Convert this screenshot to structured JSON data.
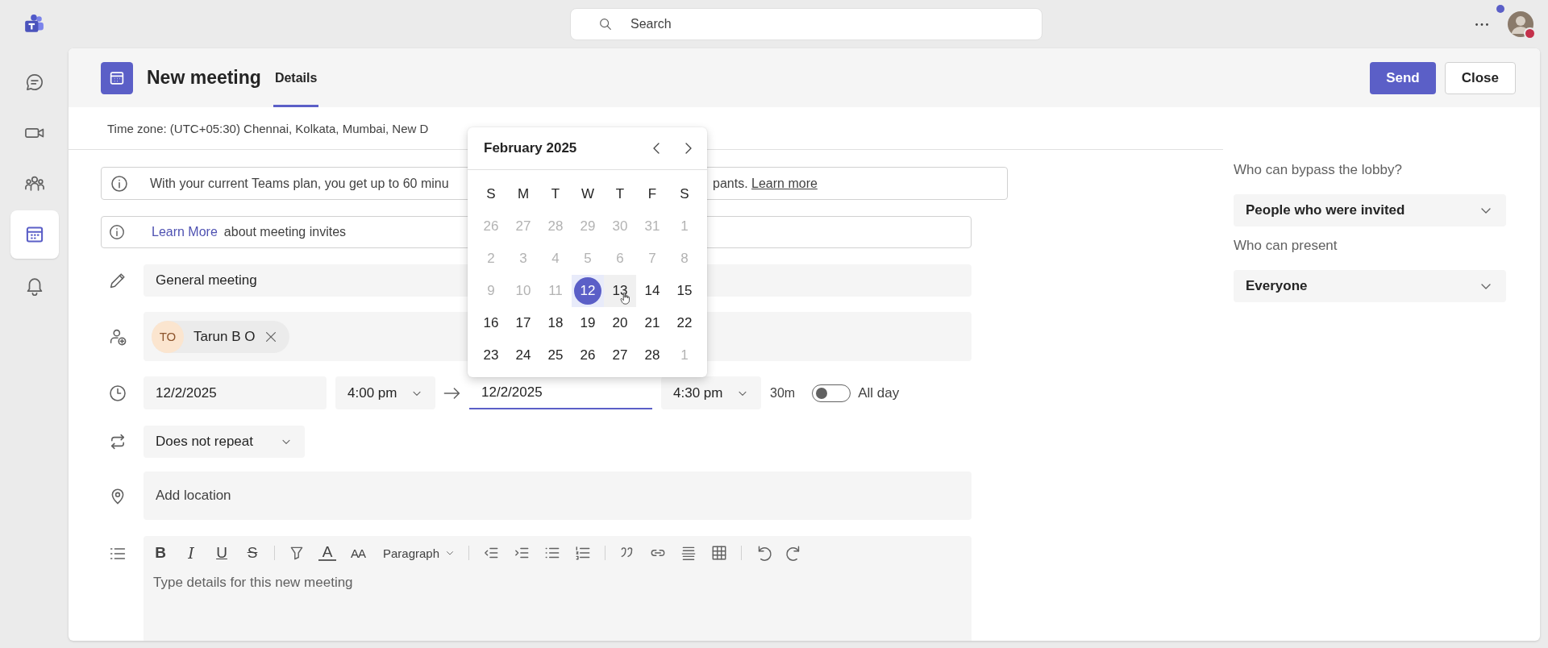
{
  "app_bar": {
    "search": {
      "placeholder": "Search"
    }
  },
  "rail": [
    {
      "kind": "chat",
      "selected": false
    },
    {
      "kind": "video",
      "selected": false
    },
    {
      "kind": "people",
      "selected": false
    },
    {
      "kind": "calendar",
      "selected": true
    },
    {
      "kind": "bell",
      "selected": false
    }
  ],
  "meeting": {
    "title": "New meeting",
    "tabs": [
      {
        "label": "Details",
        "selected": true
      }
    ],
    "buttons": [
      {
        "label": "Send",
        "kind": "primary"
      },
      {
        "label": "Close",
        "kind": "secondary"
      }
    ]
  },
  "time_zone": "Time zone: (UTC+05:30) Chennai, Kolkata, Mumbai, New D",
  "plan_notice": {
    "text": "With your current Teams plan, you get up to 60 minu",
    "text_after": "pants.",
    "link": "Learn more"
  },
  "invite_notice": {
    "link": "Learn More",
    "text": "about meeting invites"
  },
  "title_field": {
    "value": "General meeting"
  },
  "attendees": [
    {
      "initials": "TO",
      "name": "Tarun B O"
    }
  ],
  "schedule": {
    "start_date": "12/2/2025",
    "start_time": "4:00 pm",
    "end_date": "12/2/2025",
    "end_date_focused": true,
    "end_time": "4:30 pm",
    "duration": "30m",
    "all_day": {
      "label": "All day",
      "on": false
    }
  },
  "repeat": {
    "value": "Does not repeat"
  },
  "location": {
    "placeholder": "Add location"
  },
  "editor": {
    "toolbar": [
      {
        "kind": "bold",
        "label": "B"
      },
      {
        "kind": "italic",
        "label": "I"
      },
      {
        "kind": "underline",
        "label": "U"
      },
      {
        "kind": "strikethrough",
        "label": "S"
      },
      {
        "kind": "separator"
      },
      {
        "kind": "highlight"
      },
      {
        "kind": "font-color",
        "label": "A"
      },
      {
        "kind": "font-size",
        "label": "AA"
      },
      {
        "kind": "paragraph",
        "label": "Paragraph"
      },
      {
        "kind": "separator"
      },
      {
        "kind": "outdent"
      },
      {
        "kind": "indent"
      },
      {
        "kind": "bullets"
      },
      {
        "kind": "numbering"
      },
      {
        "kind": "separator"
      },
      {
        "kind": "quote"
      },
      {
        "kind": "link"
      },
      {
        "kind": "rule"
      },
      {
        "kind": "table"
      },
      {
        "kind": "separator"
      },
      {
        "kind": "undo"
      },
      {
        "kind": "redo"
      }
    ],
    "placeholder": "Type details for this new meeting"
  },
  "date_picker": {
    "month": "February 2025",
    "weekdays": [
      "S",
      "M",
      "T",
      "W",
      "T",
      "F",
      "S"
    ],
    "weeks": [
      [
        {
          "day": "26",
          "muted": true,
          "selected": false,
          "hovered": false
        },
        {
          "day": "27",
          "muted": true,
          "selected": false,
          "hovered": false
        },
        {
          "day": "28",
          "muted": true,
          "selected": false,
          "hovered": false
        },
        {
          "day": "29",
          "muted": true,
          "selected": false,
          "hovered": false
        },
        {
          "day": "30",
          "muted": true,
          "selected": false,
          "hovered": false
        },
        {
          "day": "31",
          "muted": true,
          "selected": false,
          "hovered": false
        },
        {
          "day": "1",
          "muted": true,
          "selected": false,
          "hovered": false
        }
      ],
      [
        {
          "day": "2",
          "muted": true,
          "selected": false,
          "hovered": false
        },
        {
          "day": "3",
          "muted": true,
          "selected": false,
          "hovered": false
        },
        {
          "day": "4",
          "muted": true,
          "selected": false,
          "hovered": false
        },
        {
          "day": "5",
          "muted": true,
          "selected": false,
          "hovered": false
        },
        {
          "day": "6",
          "muted": true,
          "selected": false,
          "hovered": false
        },
        {
          "day": "7",
          "muted": true,
          "selected": false,
          "hovered": false
        },
        {
          "day": "8",
          "muted": true,
          "selected": false,
          "hovered": false
        }
      ],
      [
        {
          "day": "9",
          "muted": true,
          "selected": false,
          "hovered": false
        },
        {
          "day": "10",
          "muted": true,
          "selected": false,
          "hovered": false
        },
        {
          "day": "11",
          "muted": true,
          "selected": false,
          "hovered": false
        },
        {
          "day": "12",
          "muted": false,
          "selected": true,
          "hovered": false
        },
        {
          "day": "13",
          "muted": false,
          "selected": false,
          "hovered": true
        },
        {
          "day": "14",
          "muted": false,
          "selected": false,
          "hovered": false
        },
        {
          "day": "15",
          "muted": false,
          "selected": false,
          "hovered": false
        }
      ],
      [
        {
          "day": "16",
          "muted": false,
          "selected": false,
          "hovered": false
        },
        {
          "day": "17",
          "muted": false,
          "selected": false,
          "hovered": false
        },
        {
          "day": "18",
          "muted": false,
          "selected": false,
          "hovered": false
        },
        {
          "day": "19",
          "muted": false,
          "selected": false,
          "hovered": false
        },
        {
          "day": "20",
          "muted": false,
          "selected": false,
          "hovered": false
        },
        {
          "day": "21",
          "muted": false,
          "selected": false,
          "hovered": false
        },
        {
          "day": "22",
          "muted": false,
          "selected": false,
          "hovered": false
        }
      ],
      [
        {
          "day": "23",
          "muted": false,
          "selected": false,
          "hovered": false
        },
        {
          "day": "24",
          "muted": false,
          "selected": false,
          "hovered": false
        },
        {
          "day": "25",
          "muted": false,
          "selected": false,
          "hovered": false
        },
        {
          "day": "26",
          "muted": false,
          "selected": false,
          "hovered": false
        },
        {
          "day": "27",
          "muted": false,
          "selected": false,
          "hovered": false
        },
        {
          "day": "28",
          "muted": false,
          "selected": false,
          "hovered": false
        },
        {
          "day": "1",
          "muted": true,
          "selected": false,
          "hovered": false
        }
      ]
    ]
  },
  "options": [
    {
      "label": "Who can bypass the lobby?",
      "value": "People who were invited"
    },
    {
      "label": "Who can present",
      "value": "Everyone"
    }
  ]
}
